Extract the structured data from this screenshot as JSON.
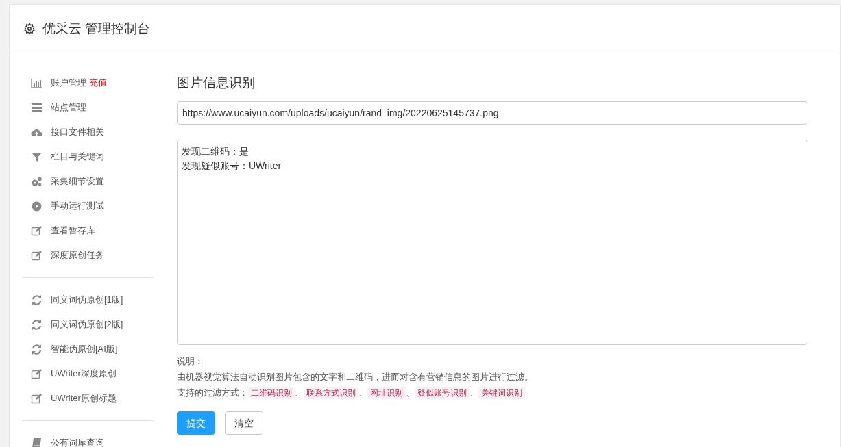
{
  "header": {
    "title": "优采云 管理控制台"
  },
  "sidebar": {
    "groups": [
      [
        {
          "label": "账户管理",
          "badge": "充值"
        },
        {
          "label": "站点管理"
        },
        {
          "label": "接口文件相关"
        },
        {
          "label": "栏目与关键词"
        },
        {
          "label": "采集细节设置"
        },
        {
          "label": "手动运行测试"
        },
        {
          "label": "查看暂存库"
        },
        {
          "label": "深度原创任务"
        }
      ],
      [
        {
          "label": "同义词伪原创[1版]"
        },
        {
          "label": "同义词伪原创[2版]"
        },
        {
          "label": "智能伪原创[AI版]"
        },
        {
          "label": "UWriter深度原创"
        },
        {
          "label": "UWriter原创标题"
        }
      ],
      [
        {
          "label": "公有词库查询"
        }
      ]
    ]
  },
  "main": {
    "title": "图片信息识别",
    "url_field": {
      "value": "https://www.ucaiyun.com/uploads/ucaiyun/rand_img/20220625145737.png"
    },
    "result_box": {
      "lines": [
        "发现二维码：是",
        "发现疑似账号：UWriter"
      ]
    },
    "notes": {
      "heading": "说明：",
      "description": "由机器视觉算法自动识别图片包含的文字和二维码，进而对含有营销信息的图片进行过滤。",
      "methods_label": "支持的过滤方式：",
      "separator": "、",
      "methods": [
        "二维码识别",
        "联系方式识别",
        "网址识别",
        "疑似账号识别",
        "关键词识别"
      ]
    },
    "buttons": [
      {
        "label": "提交",
        "kind": "primary"
      },
      {
        "label": "清空",
        "kind": "default"
      }
    ]
  }
}
